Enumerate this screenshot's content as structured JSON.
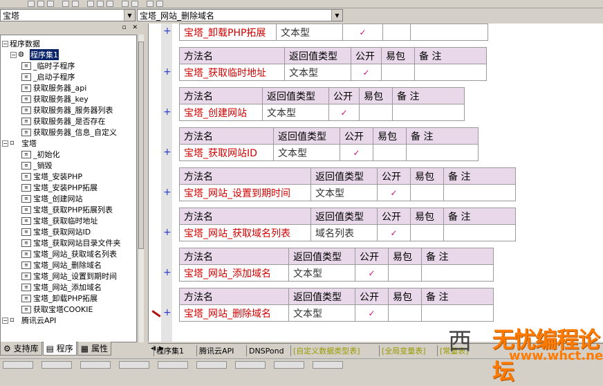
{
  "combos": {
    "left_value": "宝塔",
    "right_value": "宝塔_网站_删除域名"
  },
  "tree": {
    "root": "程序数据",
    "items": [
      {
        "label": "程序集1",
        "kind": "group",
        "selected": true
      },
      {
        "label": "_临时子程序",
        "kind": "method"
      },
      {
        "label": "_启动子程序",
        "kind": "method"
      },
      {
        "label": "获取服务器_api",
        "kind": "method"
      },
      {
        "label": "获取服务器_key",
        "kind": "method"
      },
      {
        "label": "获取服务器_服务器列表",
        "kind": "method"
      },
      {
        "label": "获取服务器_是否存在",
        "kind": "method"
      },
      {
        "label": "获取服务器_信息_自定义",
        "kind": "method"
      },
      {
        "label": "宝塔",
        "kind": "class"
      },
      {
        "label": "_初始化",
        "kind": "method"
      },
      {
        "label": "_销毁",
        "kind": "method"
      },
      {
        "label": "宝塔_安装PHP",
        "kind": "method"
      },
      {
        "label": "宝塔_安装PHP拓展",
        "kind": "method"
      },
      {
        "label": "宝塔_创建网站",
        "kind": "method"
      },
      {
        "label": "宝塔_获取PHP拓展列表",
        "kind": "method"
      },
      {
        "label": "宝塔_获取临时地址",
        "kind": "method"
      },
      {
        "label": "宝塔_获取网站ID",
        "kind": "method"
      },
      {
        "label": "宝塔_获取网站目录文件夹",
        "kind": "method"
      },
      {
        "label": "宝塔_网站_获取域名列表",
        "kind": "method"
      },
      {
        "label": "宝塔_网站_删除域名",
        "kind": "method"
      },
      {
        "label": "宝塔_网站_设置到期时间",
        "kind": "method"
      },
      {
        "label": "宝塔_网站_添加域名",
        "kind": "method"
      },
      {
        "label": "宝塔_卸载PHP拓展",
        "kind": "method"
      },
      {
        "label": "获取宝塔COOKIE",
        "kind": "method"
      },
      {
        "label": "腾讯云API",
        "kind": "class"
      }
    ]
  },
  "left_tabs": [
    "支持库",
    "程序",
    "属性"
  ],
  "table_headers": {
    "name": "方法名",
    "return_type": "返回值类型",
    "public": "公开",
    "easy_pack": "易包",
    "note": "备 注"
  },
  "methods": [
    {
      "name": "宝塔_卸载PHP拓展",
      "return_type": "文本型",
      "public": "✓",
      "header": false
    },
    {
      "name": "宝塔_获取临时地址",
      "return_type": "文本型",
      "public": "✓",
      "header": true
    },
    {
      "name": "宝塔_创建网站",
      "return_type": "文本型",
      "public": "✓",
      "header": true
    },
    {
      "name": "宝塔_获取网站ID",
      "return_type": "文本型",
      "public": "✓",
      "header": true
    },
    {
      "name": "宝塔_网站_设置到期时间",
      "return_type": "文本型",
      "public": "✓",
      "header": true
    },
    {
      "name": "宝塔_网站_获取域名列表",
      "return_type": "域名列表",
      "public": "✓",
      "header": true
    },
    {
      "name": "宝塔_网站_添加域名",
      "return_type": "文本型",
      "public": "✓",
      "header": true
    },
    {
      "name": "宝塔_网站_删除域名",
      "return_type": "文本型",
      "public": "✓",
      "header": true
    }
  ],
  "editor_tabs": [
    "程序集1",
    "腾讯云API",
    "DNSPond",
    "[自定义数据类型表]",
    "[全局变量表]",
    "[常量表]"
  ],
  "watermark": {
    "left": "西",
    "main": "无忧编程论坛",
    "url": "www.whct.net"
  }
}
